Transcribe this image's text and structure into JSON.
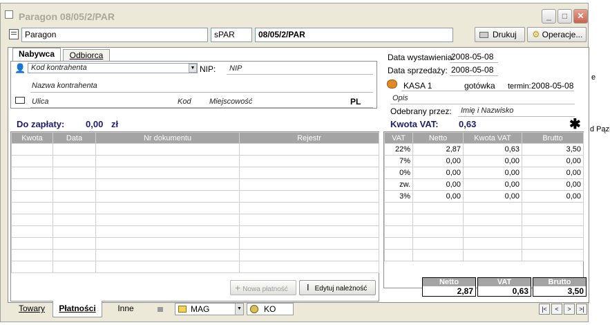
{
  "window": {
    "title": "Paragon 08/05/2/PAR"
  },
  "background": {
    "text1": "e",
    "text2": "d Pązi"
  },
  "header": {
    "doc_type": "Paragon",
    "series": "sPAR",
    "number": "08/05/2/PAR",
    "print_label": "Drukuj",
    "operations_label": "Operacje..."
  },
  "party": {
    "tabs": [
      "Nabywca",
      "Odbiorca"
    ],
    "contractor_code_placeholder": "Kod kontrahenta",
    "nip_label": "NIP:",
    "nip_value": "NIP",
    "name_placeholder": "Nazwa kontrahenta",
    "street": "Ulica",
    "postal_code": "Kod",
    "city": "Miejscowość",
    "country": "PL"
  },
  "details": {
    "issue_date_label": "Data wystawienia:",
    "issue_date": "2008-05-08",
    "sale_date_label": "Data sprzedaży:",
    "sale_date": "2008-05-08",
    "register": "KASA 1",
    "payment_method": "gotówka",
    "due_label": "termin:",
    "due_date": "2008-05-08",
    "description": "Opis",
    "received_label": "Odebrany przez:",
    "received_by": "Imię i Nazwisko"
  },
  "payment": {
    "due_label": "Do zapłaty:",
    "due_amount": "0,00",
    "currency": "zł",
    "columns": [
      "Kwota",
      "Data",
      "Nr dokumentu",
      "Rejestr"
    ],
    "empty_rows": 11
  },
  "vat": {
    "label": "Kwota VAT:",
    "amount": "0,63",
    "columns": [
      "VAT",
      "Netto",
      "Kwota VAT",
      "Brutto"
    ],
    "rows": [
      [
        "22%",
        "2,87",
        "0,63",
        "3,50"
      ],
      [
        "7%",
        "0,00",
        "0,00",
        "0,00"
      ],
      [
        "0%",
        "0,00",
        "0,00",
        "0,00"
      ],
      [
        "zw.",
        "0,00",
        "0,00",
        "0,00"
      ],
      [
        "3%",
        "0,00",
        "0,00",
        "0,00"
      ]
    ],
    "empty_rows": 5
  },
  "actions": {
    "new_payment": "Nowa płatność",
    "edit_receivable": "Edytuj należność"
  },
  "totals": [
    {
      "label": "Netto",
      "value": "2,87"
    },
    {
      "label": "VAT",
      "value": "0,63"
    },
    {
      "label": "Brutto",
      "value": "3,50"
    }
  ],
  "bottom": {
    "tabs": [
      "Towary",
      "Płatności",
      "Inne"
    ],
    "warehouse": "MAG",
    "user": "KO",
    "nav": [
      "|<",
      "<",
      ">",
      ">|"
    ]
  }
}
